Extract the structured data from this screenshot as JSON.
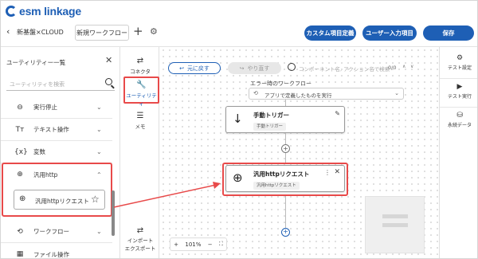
{
  "header": {
    "logo": "esm linkage",
    "back_glyph": "‹",
    "package": "新基盤×CLOUD",
    "flow_tab": "新規ワークフロー",
    "add_glyph": "+",
    "buttons": {
      "custom_fields": "カスタム項目定義",
      "user_input": "ユーザー入力項目",
      "save": "保存"
    }
  },
  "left_panel": {
    "title": "ユーティリティー一覧",
    "search_placeholder": "ユーティリティを検索",
    "categories": [
      {
        "icon": "⊖",
        "label": "実行停止"
      },
      {
        "icon": "Tт",
        "label": "テキスト操作"
      },
      {
        "icon": "{x}",
        "label": "変数"
      },
      {
        "icon": "⊕",
        "label": "汎用http"
      },
      {
        "icon": "⟲",
        "label": "ワークフロー"
      },
      {
        "icon": "▦",
        "label": "ファイル操作"
      }
    ],
    "sub_item": {
      "label": "汎用httpリクエスト"
    }
  },
  "tools": [
    {
      "icon": "⇄",
      "label": "コネクタ"
    },
    {
      "icon": "🔧",
      "label": "ユーティリティ"
    },
    {
      "icon": "☰",
      "label": "メモ"
    },
    {
      "icon": "⇄",
      "label": "インポート\nエクスポート"
    }
  ],
  "canvas": {
    "undo": "元に戻す",
    "redo": "やり直す",
    "search_placeholder": "コンポーネント名, アクション名で検索",
    "search_count": "0/0",
    "error_flow_title": "エラー時のワークフロー",
    "error_flow_value": "アプリで定義したものを実行",
    "nodes": [
      {
        "title": "手動トリガー",
        "tag": "手動トリガー"
      },
      {
        "title": "汎用httpリクエスト",
        "tag": "汎用httpリクエスト"
      }
    ],
    "zoom": "101%"
  },
  "right_panel": [
    {
      "label": "テスト設定"
    },
    {
      "label": "テスト実行"
    },
    {
      "label": "永続データ"
    }
  ],
  "colors": {
    "accent": "#1e5fb5",
    "highlight": "#e84a4a"
  }
}
